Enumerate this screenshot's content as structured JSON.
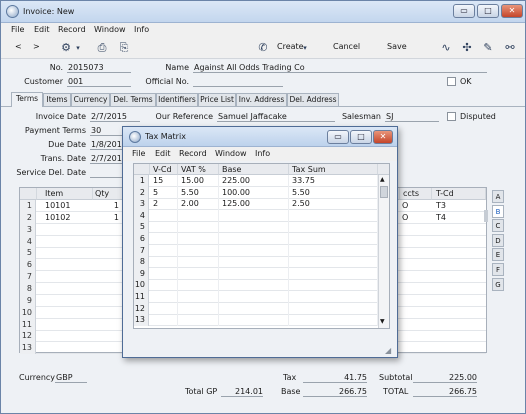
{
  "window": {
    "title": "Invoice: New",
    "menu": [
      "File",
      "Edit",
      "Record",
      "Window",
      "Info"
    ],
    "controls": {
      "minimize": "▭",
      "maximize": "□",
      "close": "✕"
    }
  },
  "toolbar": {
    "nav_prev": "<",
    "nav_next": ">",
    "create_label": "Create",
    "cancel_label": "Cancel",
    "save_label": "Save"
  },
  "header": {
    "no_label": "No.",
    "no_value": "2015073",
    "name_label": "Name",
    "name_value": "Against All Odds Trading Co",
    "customer_label": "Customer",
    "customer_value": "001",
    "official_no_label": "Official No.",
    "official_no_value": "",
    "ok_label": "OK"
  },
  "tabs": [
    "Terms",
    "Items",
    "Currency",
    "Del. Terms",
    "Identifiers",
    "Price List",
    "Inv. Address",
    "Del. Address"
  ],
  "terms": {
    "invoice_date_label": "Invoice Date",
    "invoice_date_value": "2/7/2015",
    "our_ref_label": "Our Reference",
    "our_ref_value": "Samuel Jaffacake",
    "salesman_label": "Salesman",
    "salesman_value": "SJ",
    "disputed_label": "Disputed",
    "payment_terms_label": "Payment Terms",
    "payment_terms_value": "30",
    "due_date_label": "Due Date",
    "due_date_value": "1/8/2015",
    "trans_date_label": "Trans. Date",
    "trans_date_value": "2/7/2015",
    "service_del_label": "Service Del. Date",
    "service_del_value": ""
  },
  "grid": {
    "headers": {
      "item": "Item",
      "qty": "Qty",
      "accts": "ccts",
      "tcd": "T-Cd"
    },
    "rows": [
      {
        "n": "1",
        "item": "10101",
        "qty": "1",
        "accts": "O",
        "tcd": "T3"
      },
      {
        "n": "2",
        "item": "10102",
        "qty": "1",
        "accts": "O",
        "tcd": "T4"
      },
      {
        "n": "3",
        "item": "",
        "qty": "",
        "accts": "",
        "tcd": ""
      },
      {
        "n": "4",
        "item": "",
        "qty": "",
        "accts": "",
        "tcd": ""
      },
      {
        "n": "5",
        "item": "",
        "qty": "",
        "accts": "",
        "tcd": ""
      },
      {
        "n": "6",
        "item": "",
        "qty": "",
        "accts": "",
        "tcd": ""
      },
      {
        "n": "7",
        "item": "",
        "qty": "",
        "accts": "",
        "tcd": ""
      },
      {
        "n": "8",
        "item": "",
        "qty": "",
        "accts": "",
        "tcd": ""
      },
      {
        "n": "9",
        "item": "",
        "qty": "",
        "accts": "",
        "tcd": ""
      },
      {
        "n": "10",
        "item": "",
        "qty": "",
        "accts": "",
        "tcd": ""
      },
      {
        "n": "11",
        "item": "",
        "qty": "",
        "accts": "",
        "tcd": ""
      },
      {
        "n": "12",
        "item": "",
        "qty": "",
        "accts": "",
        "tcd": ""
      },
      {
        "n": "13",
        "item": "",
        "qty": "",
        "accts": "",
        "tcd": ""
      }
    ],
    "side_tabs": [
      "A",
      "B",
      "C",
      "D",
      "E",
      "F",
      "G"
    ]
  },
  "footer": {
    "currency_label": "Currency",
    "currency_value": "GBP",
    "tax_label": "Tax",
    "tax_value": "41.75",
    "subtotal_label": "Subtotal",
    "subtotal_value": "225.00",
    "total_gp_label": "Total GP",
    "total_gp_value": "214.01",
    "base_label": "Base",
    "base_value": "266.75",
    "total_label": "TOTAL",
    "total_value": "266.75"
  },
  "tax_matrix": {
    "title": "Tax Matrix",
    "menu": [
      "File",
      "Edit",
      "Record",
      "Window",
      "Info"
    ],
    "headers": {
      "vcd": "V-Cd",
      "vat": "VAT %",
      "base": "Base",
      "tax": "Tax Sum"
    },
    "rows": [
      {
        "n": "1",
        "vcd": "15",
        "vat": "15.00",
        "base": "225.00",
        "tax": "33.75"
      },
      {
        "n": "2",
        "vcd": "5",
        "vat": "5.50",
        "base": "100.00",
        "tax": "5.50"
      },
      {
        "n": "3",
        "vcd": "2",
        "vat": "2.00",
        "base": "125.00",
        "tax": "2.50"
      },
      {
        "n": "4",
        "vcd": "",
        "vat": "",
        "base": "",
        "tax": ""
      },
      {
        "n": "5",
        "vcd": "",
        "vat": "",
        "base": "",
        "tax": ""
      },
      {
        "n": "6",
        "vcd": "",
        "vat": "",
        "base": "",
        "tax": ""
      },
      {
        "n": "7",
        "vcd": "",
        "vat": "",
        "base": "",
        "tax": ""
      },
      {
        "n": "8",
        "vcd": "",
        "vat": "",
        "base": "",
        "tax": ""
      },
      {
        "n": "9",
        "vcd": "",
        "vat": "",
        "base": "",
        "tax": ""
      },
      {
        "n": "10",
        "vcd": "",
        "vat": "",
        "base": "",
        "tax": ""
      },
      {
        "n": "11",
        "vcd": "",
        "vat": "",
        "base": "",
        "tax": ""
      },
      {
        "n": "12",
        "vcd": "",
        "vat": "",
        "base": "",
        "tax": ""
      },
      {
        "n": "13",
        "vcd": "",
        "vat": "",
        "base": "",
        "tax": ""
      }
    ]
  }
}
